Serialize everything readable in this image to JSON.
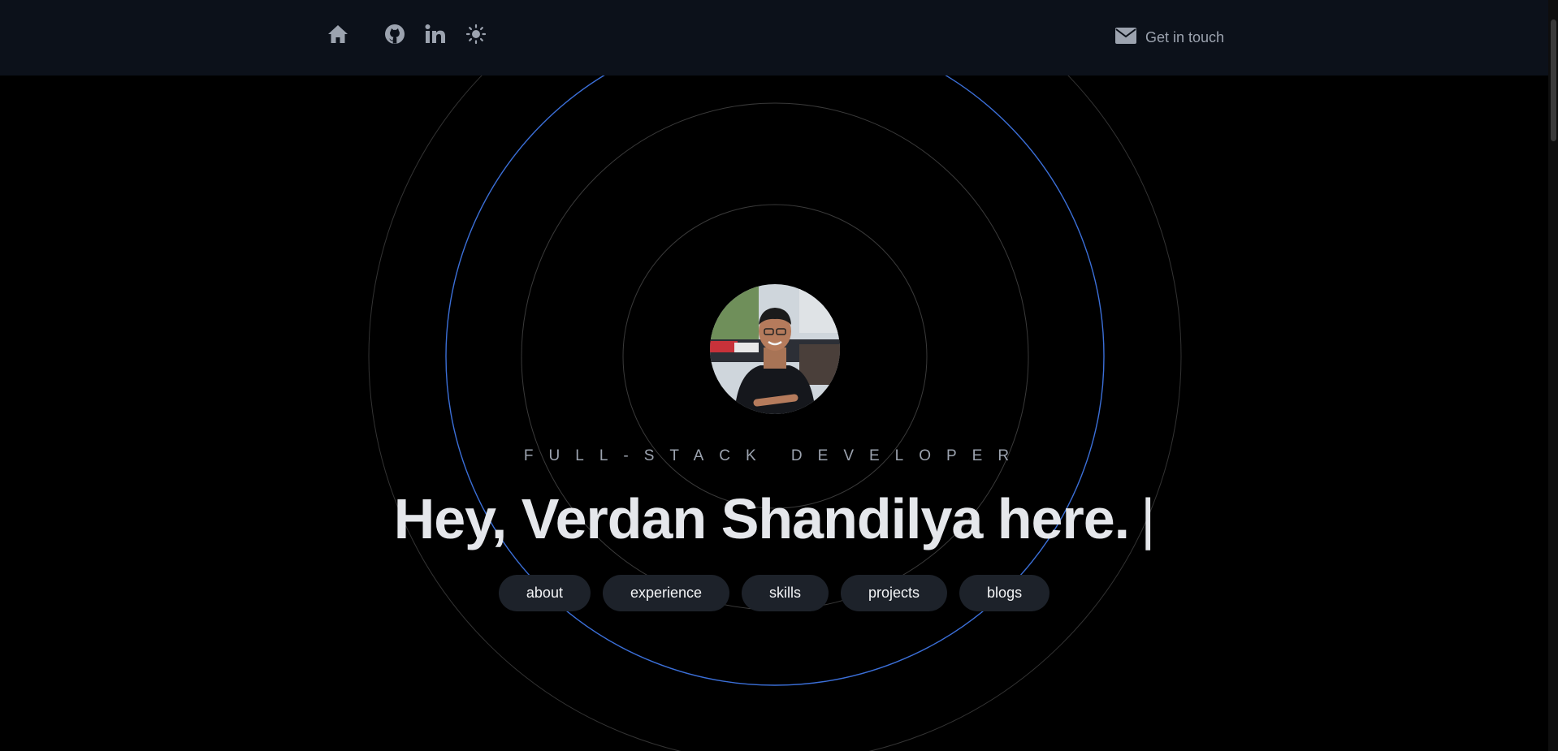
{
  "nav": {
    "home_icon": "home-icon",
    "github_icon": "github-icon",
    "linkedin_icon": "linkedin-icon",
    "theme_icon": "sun-icon",
    "contact_icon": "mail-icon",
    "contact_label": "Get in touch"
  },
  "hero": {
    "role": "FULL-STACK DEVELOPER",
    "headline": "Hey, Verdan Shandilya here.",
    "cursor": "|"
  },
  "sections": [
    {
      "label": "about"
    },
    {
      "label": "experience"
    },
    {
      "label": "skills"
    },
    {
      "label": "projects"
    },
    {
      "label": "blogs"
    }
  ],
  "colors": {
    "background": "#000000",
    "topbar": "#0c111a",
    "accent_ring": "#3b6fd8",
    "pill": "#1d222a",
    "text_primary": "#e5e7eb",
    "text_muted": "#9ca3af"
  }
}
